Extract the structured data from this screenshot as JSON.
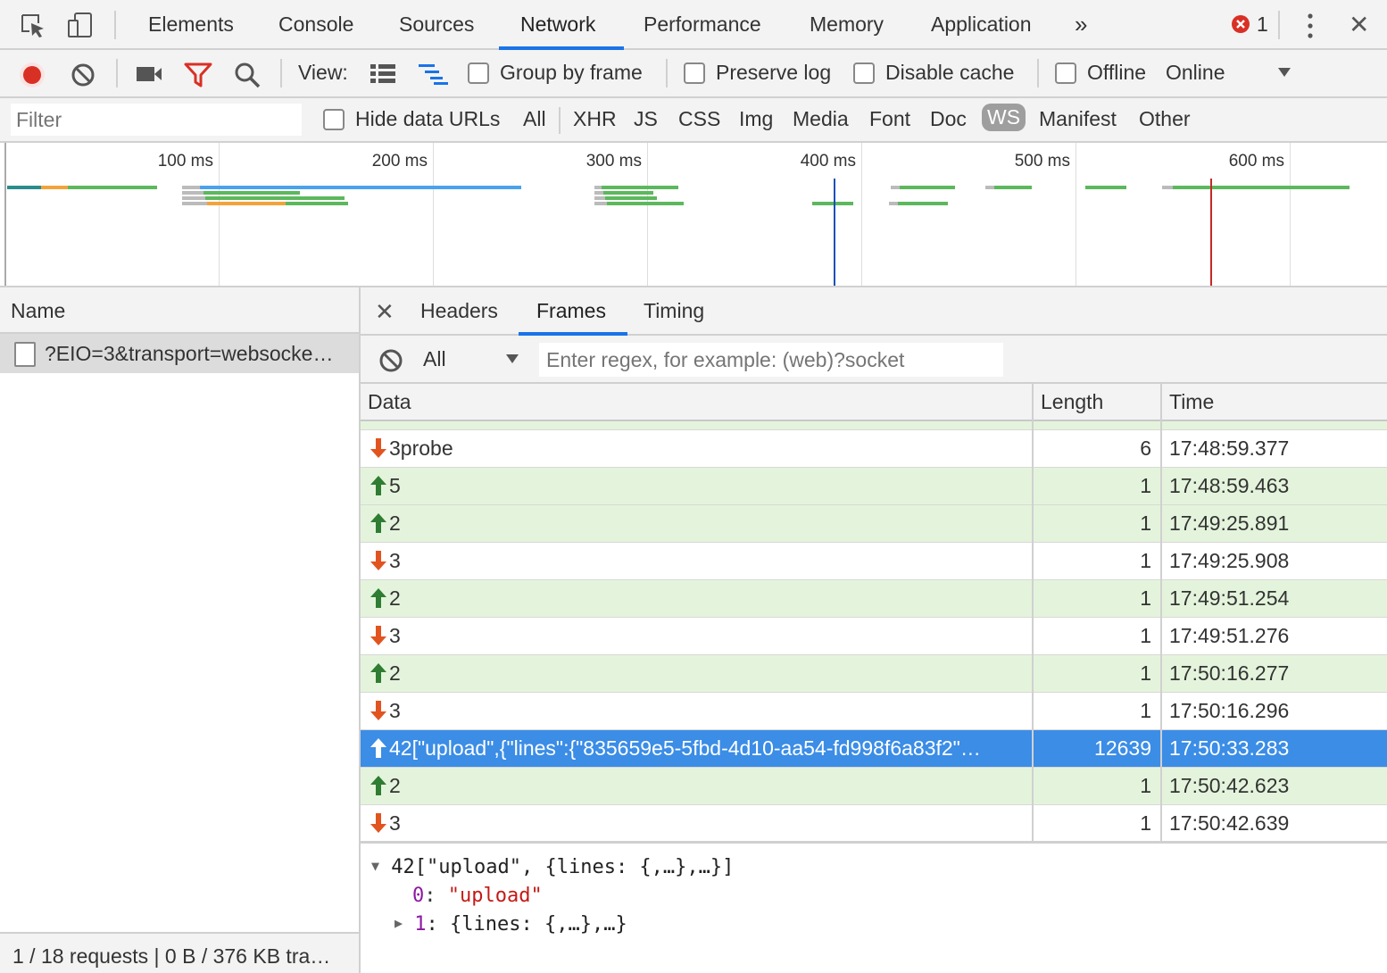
{
  "main_tabs": [
    "Elements",
    "Console",
    "Sources",
    "Network",
    "Performance",
    "Memory",
    "Application"
  ],
  "active_tab": "Network",
  "more_tabs_glyph": "»",
  "error_count": "1",
  "close_glyph": "✕",
  "toolbar": {
    "view_label": "View:",
    "group_by_frame": "Group by frame",
    "preserve_log": "Preserve log",
    "disable_cache": "Disable cache",
    "offline": "Offline",
    "throttling": "Online"
  },
  "filter_bar": {
    "filter_placeholder": "Filter",
    "hide_data_urls": "Hide data URLs",
    "types": [
      "All",
      "XHR",
      "JS",
      "CSS",
      "Img",
      "Media",
      "Font",
      "Doc",
      "WS",
      "Manifest",
      "Other"
    ],
    "active_type": "WS"
  },
  "timeline": {
    "ticks": [
      "100 ms",
      "200 ms",
      "300 ms",
      "400 ms",
      "500 ms",
      "600 ms"
    ]
  },
  "name_panel": {
    "header": "Name",
    "request": "?EIO=3&transport=websocke…",
    "footer": "1 / 18 requests | 0 B / 376 KB tra…"
  },
  "detail_tabs": [
    "Headers",
    "Frames",
    "Timing"
  ],
  "active_detail_tab": "Frames",
  "frames_filter": {
    "type": "All",
    "regex_placeholder": "Enter regex, for example: (web)?socket"
  },
  "frames_table": {
    "columns": [
      "Data",
      "Length",
      "Time"
    ],
    "rows": [
      {
        "dir": "in",
        "data": "3probe",
        "length": "6",
        "time": "17:48:59.377"
      },
      {
        "dir": "out",
        "data": "5",
        "length": "1",
        "time": "17:48:59.463"
      },
      {
        "dir": "out",
        "data": "2",
        "length": "1",
        "time": "17:49:25.891"
      },
      {
        "dir": "in",
        "data": "3",
        "length": "1",
        "time": "17:49:25.908"
      },
      {
        "dir": "out",
        "data": "2",
        "length": "1",
        "time": "17:49:51.254"
      },
      {
        "dir": "in",
        "data": "3",
        "length": "1",
        "time": "17:49:51.276"
      },
      {
        "dir": "out",
        "data": "2",
        "length": "1",
        "time": "17:50:16.277"
      },
      {
        "dir": "in",
        "data": "3",
        "length": "1",
        "time": "17:50:16.296"
      },
      {
        "dir": "out",
        "selected": true,
        "data": "42[\"upload\",{\"lines\":{\"835659e5-5fbd-4d10-aa54-fd998f6a83f2\"…",
        "length": "12639",
        "time": "17:50:33.283"
      },
      {
        "dir": "out",
        "data": "2",
        "length": "1",
        "time": "17:50:42.623"
      },
      {
        "dir": "in",
        "data": "3",
        "length": "1",
        "time": "17:50:42.639"
      }
    ]
  },
  "preview": {
    "root": "42[\"upload\", {lines: {,…},…}]",
    "item0_key": "0",
    "item0_value": "\"upload\"",
    "item1_key": "1",
    "item1_value": "{lines: {,…},…}"
  },
  "colors": {
    "accent": "#1a73e8",
    "selected_row": "#3b8de6",
    "outgoing_row": "#e4f4dc",
    "up_arrow": "#2e7d32",
    "down_arrow": "#e2541f",
    "record": "#d93025"
  }
}
